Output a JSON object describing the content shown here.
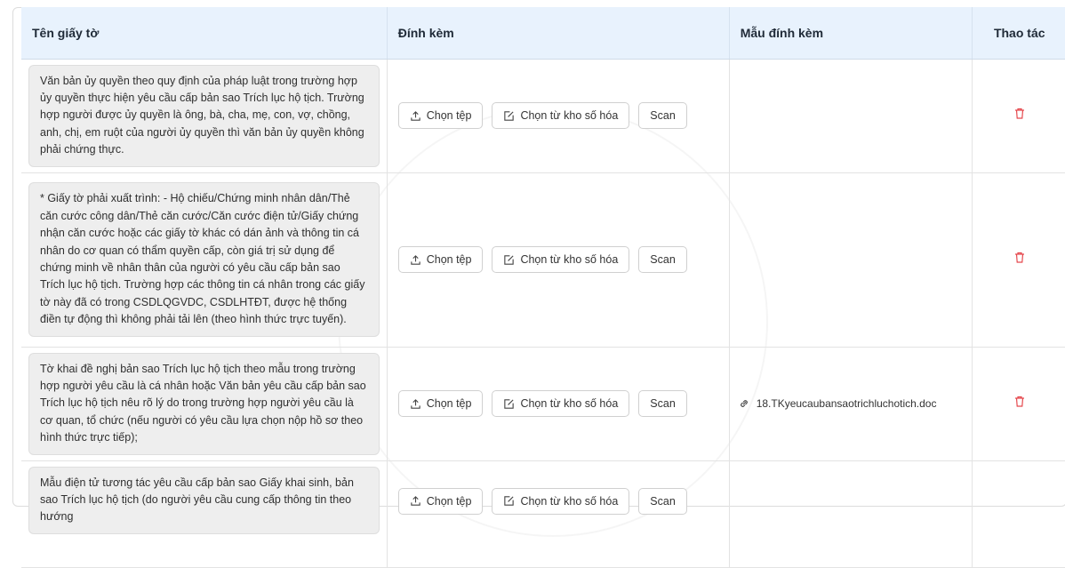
{
  "table": {
    "headers": {
      "name": "Tên giấy tờ",
      "attach": "Đính kèm",
      "sample": "Mẫu đính kèm",
      "action": "Thao tác"
    },
    "buttons": {
      "choose_file": "Chọn tệp",
      "choose_repo": "Chọn từ kho số hóa",
      "scan": "Scan"
    },
    "rows": [
      {
        "name": "Văn bản ủy quyền theo quy định của pháp luật trong trường hợp ủy quyền thực hiện yêu cầu cấp bản sao Trích lục hộ tịch. Trường hợp người được ủy quyền là ông, bà, cha, mẹ, con, vợ, chồng, anh, chị, em ruột của người ủy quyền thì văn bản ủy quyền không phải chứng thực.",
        "sample": ""
      },
      {
        "name": "* Giấy tờ phải xuất trình: - Hộ chiếu/Chứng minh nhân dân/Thẻ căn cước công dân/Thẻ căn cước/Căn cước điện tử/Giấy chứng nhận căn cước hoặc các giấy tờ khác có dán ảnh và thông tin cá nhân do cơ quan có thẩm quyền cấp, còn giá trị sử dụng để chứng minh về nhân thân của người có yêu cầu cấp bản sao Trích lục hộ tịch. Trường hợp các thông tin cá nhân trong các giấy tờ này đã có trong CSDLQGVDC, CSDLHTĐT, được hệ thống điền tự động thì không phải tải lên (theo hình thức trực tuyến).",
        "sample": ""
      },
      {
        "name": "Tờ khai đề nghị bản sao Trích lục hộ tịch theo mẫu trong trường hợp người yêu cầu là cá nhân hoặc Văn bản yêu cầu cấp bản sao Trích lục hộ tịch nêu rõ lý do trong trường hợp người yêu cầu là cơ quan, tổ chức (nếu người có yêu cầu lựa chọn nộp hồ sơ theo hình thức trực tiếp);",
        "sample": "18.TKyeucaubansaotrichluchotich.doc"
      },
      {
        "name": "Mẫu điện tử tương tác yêu cầu cấp bản sao Giấy khai sinh, bản sao Trích lục hộ tịch (do người yêu cầu cung cấp thông tin theo hướng",
        "sample": ""
      }
    ]
  },
  "colors": {
    "header_bg": "#e8f2fd",
    "delete_icon": "#e5484d"
  }
}
